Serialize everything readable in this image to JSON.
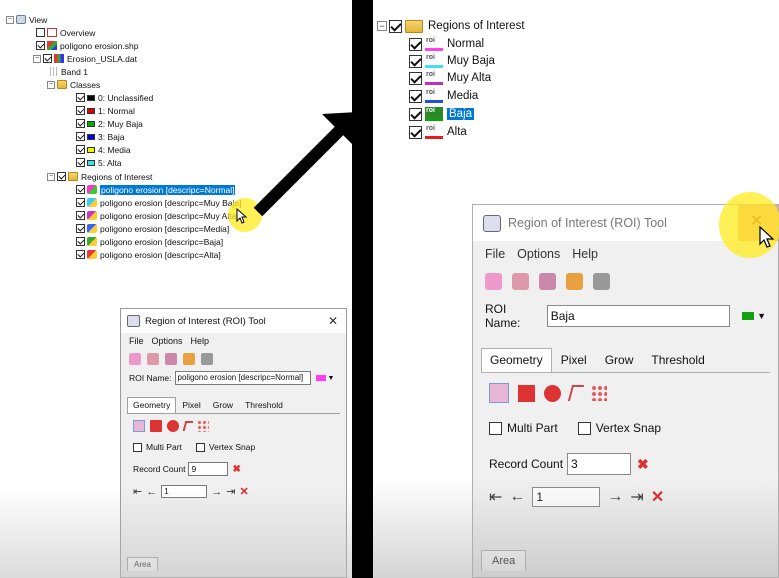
{
  "left_tree": {
    "view": "View",
    "overview": "Overview",
    "shapefile": "poligono erosion.shp",
    "raster": "Erosion_USLA.dat",
    "band": "Band 1",
    "classes_folder": "Classes",
    "classes": [
      {
        "label": "0: Unclassified",
        "color": "#000000"
      },
      {
        "label": "1: Normal",
        "color": "#e00000"
      },
      {
        "label": "2: Muy Baja",
        "color": "#00b000"
      },
      {
        "label": "3: Baja",
        "color": "#0000e0"
      },
      {
        "label": "4: Media",
        "color": "#f4f000"
      },
      {
        "label": "5: Alta",
        "color": "#40e0f0"
      }
    ],
    "roi_folder": "Regions of Interest",
    "rois": [
      {
        "label": "poligono erosion [descripc=Normal]",
        "selected": true
      },
      {
        "label": "poligono erosion [descripc=Muy Baja]",
        "selected": false
      },
      {
        "label": "poligono erosion [descripc=Muy Alta]",
        "selected": false
      },
      {
        "label": "poligono erosion [descripc=Media]",
        "selected": false
      },
      {
        "label": "poligono erosion [descripc=Baja]",
        "selected": false
      },
      {
        "label": "poligono erosion [descripc=Alta]",
        "selected": false
      }
    ]
  },
  "roi_tool_small": {
    "title": "Region of Interest (ROI) Tool",
    "menu": [
      "File",
      "Options",
      "Help"
    ],
    "roi_name_label": "ROI Name:",
    "roi_name_value": "poligono erosion [descripc=Normal]",
    "roi_color": "#ff3df0",
    "tabs": [
      "Geometry",
      "Pixel",
      "Grow",
      "Threshold"
    ],
    "multi_part": "Multi Part",
    "vertex_snap": "Vertex Snap",
    "record_count_label": "Record Count",
    "record_count_value": "9",
    "nav_value": "1",
    "bottom_tab": "Area"
  },
  "right_tree": {
    "folder": "Regions of Interest",
    "rois": [
      {
        "label": "Normal",
        "color": "#ff3df0",
        "selected": false
      },
      {
        "label": "Muy Baja",
        "color": "#40e0f0",
        "selected": false
      },
      {
        "label": "Muy Alta",
        "color": "#c030c0",
        "selected": false
      },
      {
        "label": "Media",
        "color": "#2050e0",
        "selected": false
      },
      {
        "label": "Baja",
        "color": "#10a010",
        "selected": true
      },
      {
        "label": "Alta",
        "color": "#e02020",
        "selected": false
      }
    ]
  },
  "roi_tool_big": {
    "title": "Region of Interest (ROI) Tool",
    "menu": [
      "File",
      "Options",
      "Help"
    ],
    "roi_name_label": "ROI Name:",
    "roi_name_value": "Baja",
    "roi_color": "#10a010",
    "tabs": [
      "Geometry",
      "Pixel",
      "Grow",
      "Threshold"
    ],
    "multi_part": "Multi Part",
    "vertex_snap": "Vertex Snap",
    "record_count_label": "Record Count",
    "record_count_value": "3",
    "nav_value": "1",
    "bottom_tab": "Area"
  }
}
